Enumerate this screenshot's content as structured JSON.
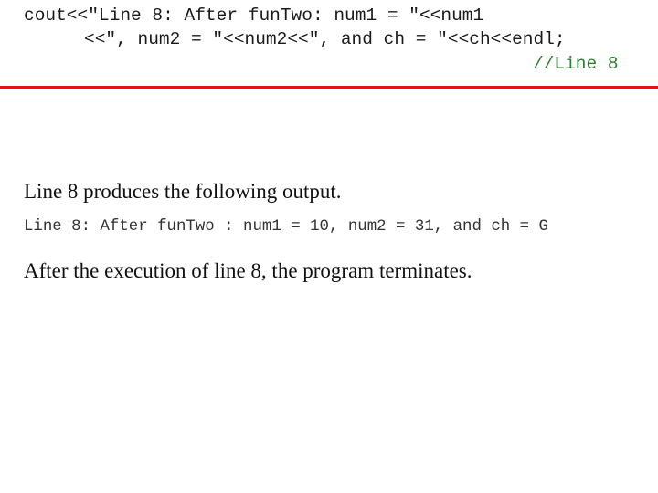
{
  "code": {
    "line1": "cout<<\"Line 8: After funTwo: num1 = \"<<num1",
    "line2": "<<\", num2 = \"<<num2<<\", and ch = \"<<ch<<endl;",
    "comment": "//Line 8"
  },
  "colors": {
    "rule": "#e0141c",
    "comment": "#2e7d32"
  },
  "body": {
    "intro": "Line 8 produces the following output.",
    "output": "Line 8: After funTwo : num1 = 10, num2 = 31, and ch = G",
    "conclusion": "After the execution of line 8, the program terminates."
  }
}
